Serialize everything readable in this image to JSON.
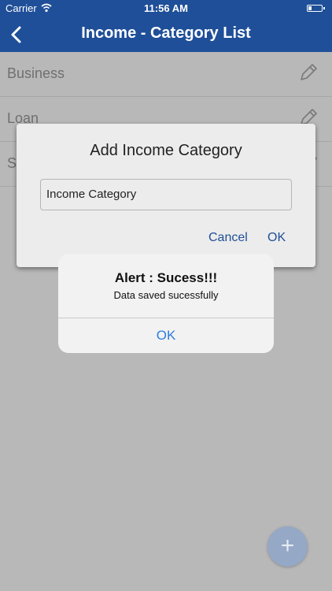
{
  "status_bar": {
    "carrier": "Carrier",
    "time": "11:56 AM"
  },
  "nav": {
    "title": "Income - Category List",
    "back_icon": "chevron-left-icon"
  },
  "list": {
    "items": [
      {
        "label": "Business",
        "edit_icon": "pencil-icon"
      },
      {
        "label": "Loan",
        "edit_icon": "pencil-icon"
      },
      {
        "label": "S",
        "edit_icon": "pencil-icon"
      }
    ]
  },
  "dialog": {
    "title": "Add Income Category",
    "field_value": "Income Category",
    "cancel_label": "Cancel",
    "ok_label": "OK"
  },
  "alert": {
    "title": "Alert : Sucess!!!",
    "message": "Data saved sucessfully",
    "ok_label": "OK"
  },
  "fab": {
    "label": "+",
    "icon": "plus-icon"
  },
  "colors": {
    "nav_bg": "#1f4f98",
    "alert_button": "#2a7de1",
    "fab_bg": "#95a8c6"
  }
}
